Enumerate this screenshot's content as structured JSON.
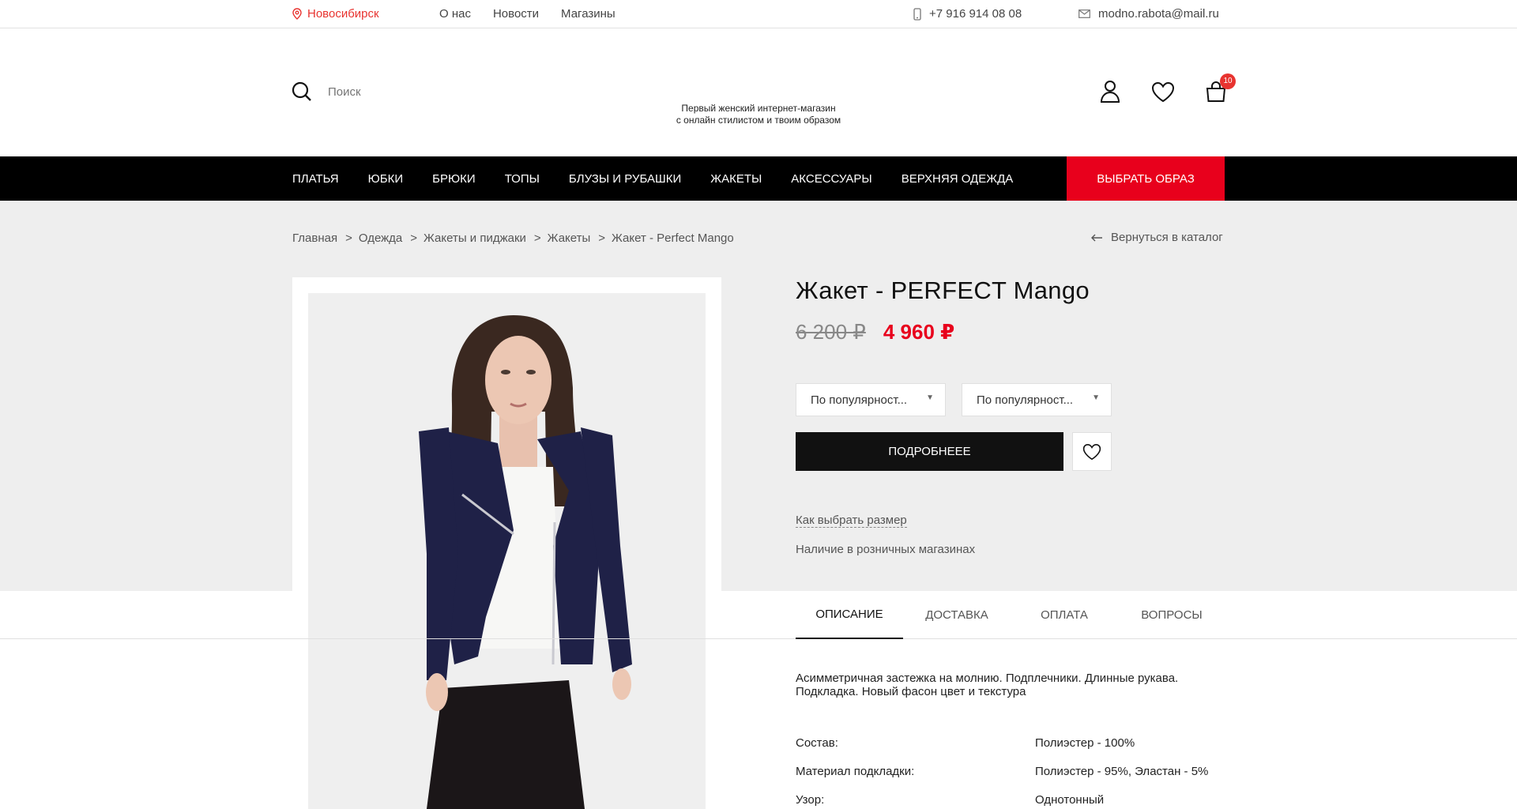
{
  "topbar": {
    "city": "Новосибирск",
    "links": [
      "О нас",
      "Новости",
      "Магазины"
    ],
    "phone": "+7 916 914 08 08",
    "email": "modno.rabota@mail.ru"
  },
  "header": {
    "search_placeholder": "Поиск",
    "tagline_line1": "Первый женский интернет-магазин",
    "tagline_line2": "с онлайн стилистом и твоим образом",
    "cart_count": "10"
  },
  "nav": {
    "items": [
      "ПЛАТЬЯ",
      "ЮБКИ",
      "БРЮКИ",
      "ТОПЫ",
      "БЛУЗЫ И РУБАШКИ",
      "ЖАКЕТЫ",
      "АКСЕССУАРЫ",
      "ВЕРХНЯЯ ОДЕЖДА"
    ],
    "cta": "ВЫБРАТЬ ОБРАЗ"
  },
  "breadcrumb": {
    "items": [
      "Главная",
      "Одежда",
      "Жакеты и пиджаки",
      "Жакеты",
      "Жакет - Perfect Mango"
    ],
    "back": "Вернуться в каталог"
  },
  "product": {
    "title": "Жакет - PERFECT Mango",
    "old_price": "6 200 ₽",
    "new_price": "4 960 ₽",
    "select1": "По популярност...",
    "select2": "По популярност...",
    "more_button": "ПОДРОБНЕЕЕ",
    "size_link": "Как выбрать размер",
    "stock_link": "Наличие в розничных магазинах"
  },
  "tabs": [
    "ОПИСАНИЕ",
    "ДОСТАВКА",
    "ОПЛАТА",
    "ВОПРОСЫ"
  ],
  "description": "Асимметричная застежка на молнию. Подплечники. Длинные рукава. Подкладка. Новый фасон цвет и текстура",
  "specs": [
    {
      "k": "Состав:",
      "v": "Полиэстер - 100%"
    },
    {
      "k": "Материал подкладки:",
      "v": "Полиэстер - 95%, Эластан - 5%"
    },
    {
      "k": "Узор:",
      "v": "Однотонный"
    }
  ],
  "colors": {
    "accent": "#e8001c",
    "nav_bg": "#000000",
    "band_bg": "#eeeeee"
  }
}
